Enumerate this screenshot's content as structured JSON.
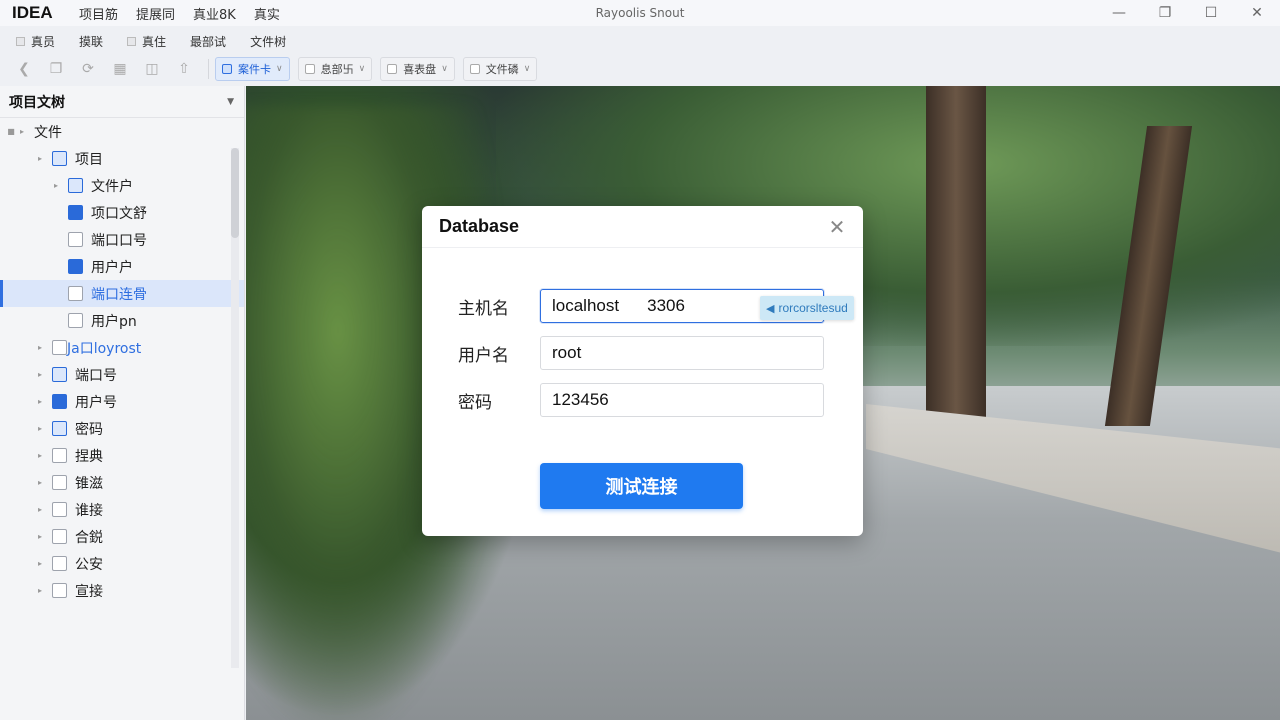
{
  "titlebar": {
    "app_name": "IDEA",
    "menu": [
      "项目筋",
      "提展同",
      "真业8K",
      "真实"
    ],
    "window_title": "Rayoolis Snout",
    "controls": [
      "minimize-icon",
      "restore-icon",
      "maximize-icon",
      "close-icon"
    ]
  },
  "menubar": {
    "items": [
      "真员",
      "摸联",
      "真住",
      "最部试",
      "文件树"
    ]
  },
  "toolbar": {
    "dropdowns": [
      {
        "label": "案件卡",
        "active": true
      },
      {
        "label": "息部卐",
        "active": false
      },
      {
        "label": "喜表盘",
        "active": false
      },
      {
        "label": "文件磷",
        "active": false
      }
    ]
  },
  "sidebar": {
    "title": "项目文树",
    "tree": [
      {
        "label": "文件",
        "level": 0
      },
      {
        "label": "项目",
        "level": 1
      },
      {
        "label": "文件户",
        "level": 2
      },
      {
        "label": "项口文舒",
        "level": 2
      },
      {
        "label": "端口口号",
        "level": 2
      },
      {
        "label": "用户户",
        "level": 2
      },
      {
        "label": "端口连骨",
        "level": 2,
        "selected": true
      },
      {
        "label": "用户pn",
        "level": 2
      },
      {
        "label": "Ja口loyrost",
        "level": 1
      },
      {
        "label": "端口号",
        "level": 1
      },
      {
        "label": "用户号",
        "level": 1
      },
      {
        "label": "密码",
        "level": 1
      },
      {
        "label": "捏典",
        "level": 1
      },
      {
        "label": "锥滋",
        "level": 1
      },
      {
        "label": "谁接",
        "level": 1
      },
      {
        "label": "合鋭",
        "level": 1
      },
      {
        "label": "公安",
        "level": 1
      },
      {
        "label": "宣接",
        "level": 1
      }
    ]
  },
  "dialog": {
    "title": "Database",
    "host_label": "主机名",
    "host_value": "localhost",
    "port_value": "3306",
    "user_label": "用户名",
    "user_value": "root",
    "password_label": "密码",
    "password_value": "123456",
    "test_button": "测试连接",
    "autocomplete": "rorcorsltesud"
  },
  "colors": {
    "accent": "#1f7af0",
    "selection": "#dbe6fa"
  }
}
